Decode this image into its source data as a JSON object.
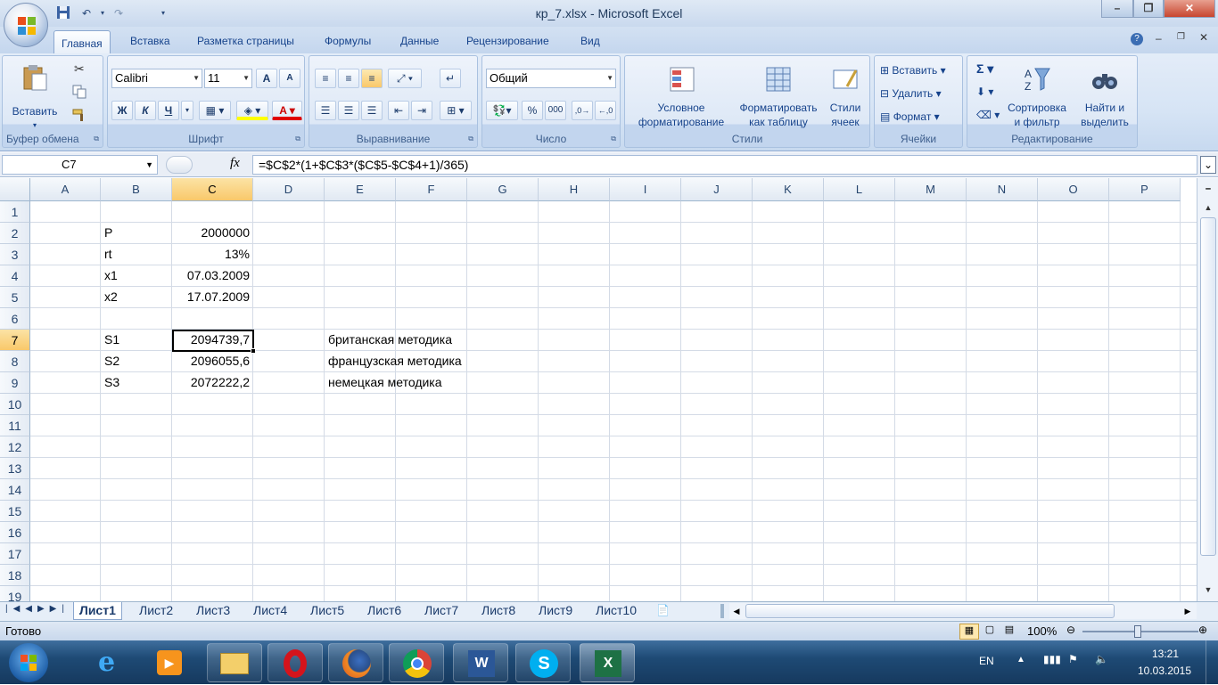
{
  "window": {
    "title": "кр_7.xlsx - Microsoft Excel"
  },
  "tabs": [
    "Главная",
    "Вставка",
    "Разметка страницы",
    "Формулы",
    "Данные",
    "Рецензирование",
    "Вид"
  ],
  "ribbon": {
    "clipboard": {
      "paste": "Вставить",
      "label": "Буфер обмена"
    },
    "font": {
      "name": "Calibri",
      "size": "11",
      "bold": "Ж",
      "italic": "К",
      "underline": "Ч",
      "grow": "A",
      "shrink": "A",
      "label": "Шрифт"
    },
    "alignment": {
      "label": "Выравнивание"
    },
    "number": {
      "format": "Общий",
      "percent": "%",
      "thousands": "000",
      "label": "Число"
    },
    "styles": {
      "conditional_line1": "Условное",
      "conditional_line2": "форматирование",
      "table_line1": "Форматировать",
      "table_line2": "как таблицу",
      "cell_line1": "Стили",
      "cell_line2": "ячеек",
      "label": "Стили"
    },
    "cells": {
      "insert": "Вставить",
      "delete": "Удалить",
      "format": "Формат",
      "label": "Ячейки"
    },
    "editing": {
      "sum": "Σ",
      "sort_line1": "Сортировка",
      "sort_line2": "и фильтр",
      "find_line1": "Найти и",
      "find_line2": "выделить",
      "label": "Редактирование"
    }
  },
  "formula_bar": {
    "name_box": "C7",
    "fx": "fx",
    "formula": "=$C$2*(1+$C$3*($C$5-$C$4+1)/365)"
  },
  "columns": [
    "A",
    "B",
    "C",
    "D",
    "E",
    "F",
    "G",
    "H",
    "I",
    "J",
    "K",
    "L",
    "M",
    "N",
    "O",
    "P"
  ],
  "rows": [
    "1",
    "2",
    "3",
    "4",
    "5",
    "6",
    "7",
    "8",
    "9",
    "10",
    "11",
    "12",
    "13",
    "14",
    "15",
    "16",
    "17",
    "18",
    "19"
  ],
  "cells": {
    "B2": "P",
    "C2": "2000000",
    "B3": "rt",
    "C3": "13%",
    "B4": "x1",
    "C4": "07.03.2009",
    "B5": "x2",
    "C5": "17.07.2009",
    "B7": "S1",
    "C7": "2094739,7",
    "E7": "британская методика",
    "B8": "S2",
    "C8": "2096055,6",
    "E8": "французская методика",
    "B9": "S3",
    "C9": "2072222,2",
    "E9": "немецкая методика"
  },
  "sheets": [
    "Лист1",
    "Лист2",
    "Лист3",
    "Лист4",
    "Лист5",
    "Лист6",
    "Лист7",
    "Лист8",
    "Лист9",
    "Лист10"
  ],
  "status": {
    "ready": "Готово",
    "zoom": "100%"
  },
  "taskbar": {
    "lang": "EN",
    "time": "13:21",
    "date": "10.03.2015"
  },
  "colors": {
    "accent": "#15428b",
    "selection": "#f9c86a"
  }
}
